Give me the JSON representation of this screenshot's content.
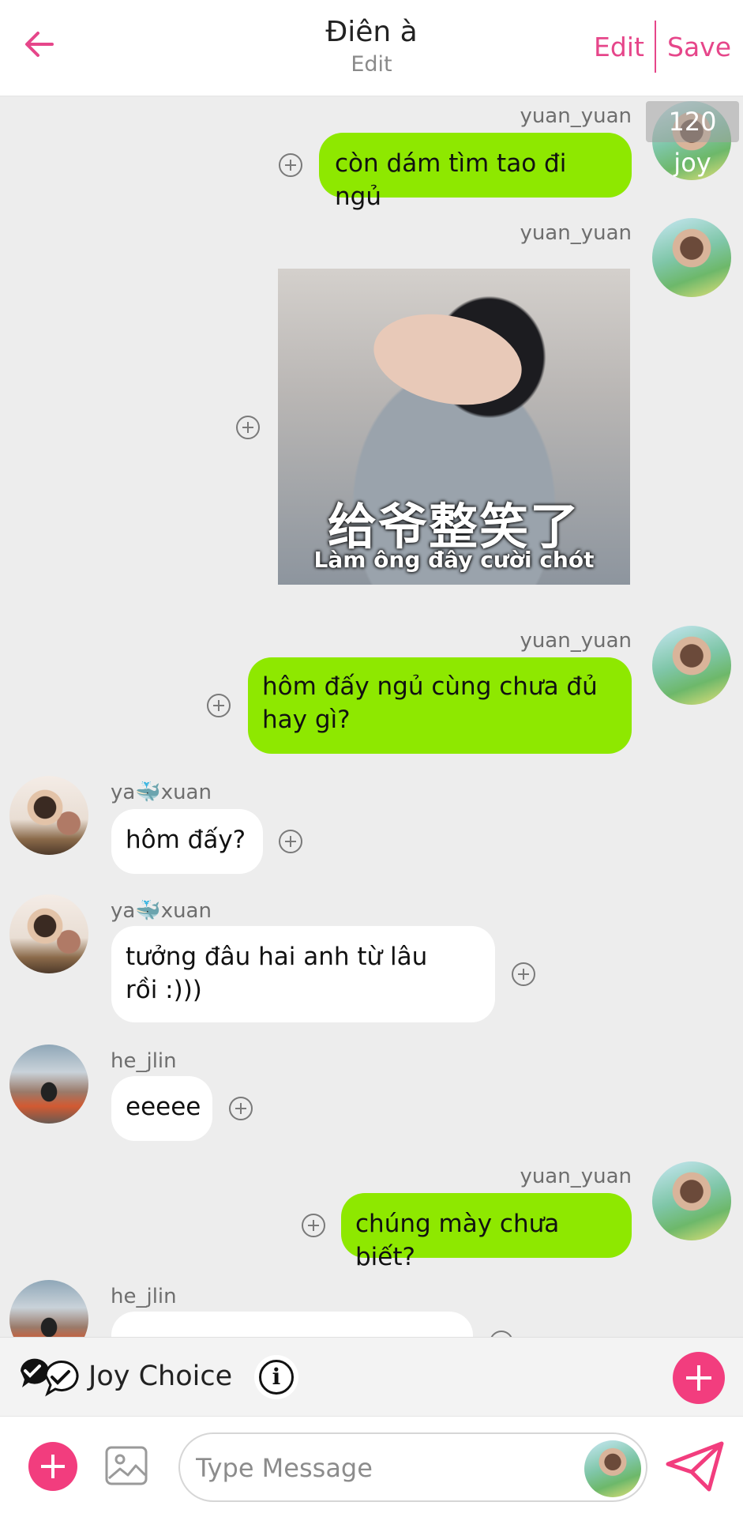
{
  "header": {
    "title": "Điên à",
    "subtitle": "Edit",
    "edit_label": "Edit",
    "save_label": "Save"
  },
  "joy_badge": "120 joy",
  "messages": [
    {
      "sender": "yuan_yuan",
      "side": "right",
      "type": "text",
      "lines": [
        "còn dám tìm tao đi ngủ"
      ]
    },
    {
      "sender": "yuan_yuan",
      "side": "right",
      "type": "sticker",
      "caption_cn": "给爷整笑了",
      "caption_vn": "Làm ông đây cười chót"
    },
    {
      "sender": "yuan_yuan",
      "side": "right",
      "type": "text",
      "lines": [
        "hôm đấy ngủ cùng chưa đủ",
        "hay gì?"
      ]
    },
    {
      "sender": "ya🐳xuan",
      "side": "left",
      "type": "text",
      "lines": [
        "hôm đấy?"
      ]
    },
    {
      "sender": "ya🐳xuan",
      "side": "left",
      "type": "text",
      "lines": [
        "tưởng đâu hai anh từ lâu",
        "rồi :)))"
      ]
    },
    {
      "sender": "he_jlin",
      "side": "left",
      "type": "text",
      "lines": [
        "eeeee"
      ]
    },
    {
      "sender": "yuan_yuan",
      "side": "right",
      "type": "text",
      "lines": [
        "chúng mày chưa biết?"
      ]
    },
    {
      "sender": "he_jlin",
      "side": "left",
      "type": "text",
      "lines": [
        ""
      ]
    }
  ],
  "joy_choice": {
    "label": "Joy Choice",
    "info_glyph": "i",
    "check_icon": "double-check-icon"
  },
  "composer": {
    "placeholder": "Type Message",
    "attach_icon": "plus-icon",
    "image_icon": "image-icon",
    "send_icon": "send-icon"
  },
  "colors": {
    "accent": "#e6468a",
    "fab": "#f23d7e",
    "bubble_me": "#8ee800",
    "bubble_other": "#ffffff",
    "background": "#ededed"
  }
}
